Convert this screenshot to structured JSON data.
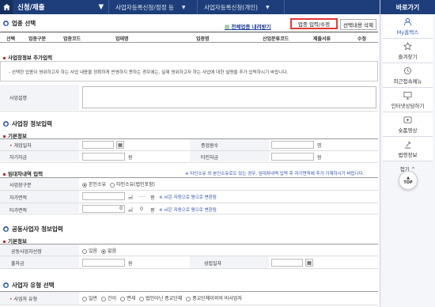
{
  "breadcrumb": {
    "first": "신청/제출",
    "second": "사업자등록신청/정정 등",
    "third": "사업자등록신청(개인)"
  },
  "sidebar": {
    "title": "바로가기",
    "items": [
      {
        "label": "My홈택스",
        "icon": "person-icon"
      },
      {
        "label": "즐겨찾기",
        "icon": "star-icon"
      },
      {
        "label": "최근접속메뉴",
        "icon": "clock-icon"
      },
      {
        "label": "인터넷상담하기",
        "icon": "monitor-icon"
      },
      {
        "label": "숏폼영상",
        "icon": "play-icon"
      },
      {
        "label": "법령정보",
        "icon": "scale-icon"
      }
    ],
    "collapse": "접기 ^",
    "top": "TOP"
  },
  "industry": {
    "title": "업종 선택",
    "download_link": "전체업종 내려받기",
    "input_button": "업종 입력/수정",
    "delete_button": "선택내용 삭제",
    "columns": [
      "선택",
      "업종구분",
      "업종코드",
      "업태명",
      "업종명",
      "산업분류코드",
      "제출서류",
      "수정"
    ]
  },
  "business_info_extra": {
    "title": "사업장정보 추가입력",
    "desc": "- 선택한 업종이 영위하고자 하는 사업 내용을 정확하게 반영하지 못하는 경우에는, 실제 영위하고자 하는 사업에 대한 설명을 추가 입력하시기 바랍니다.",
    "field_label": "사업설명"
  },
  "business_info": {
    "title": "사업장 정보입력",
    "basic_title": "기본정보",
    "open_date": "개업일자",
    "employees": "종업원수",
    "employees_unit": "명",
    "own_funds": "자기자금",
    "own_funds_unit": "원",
    "other_funds": "타인자금",
    "other_funds_unit": "원",
    "lease_title": "임대차내역 입력",
    "lease_note": "※ 타인소유 외 본인소유로도 있는 경우, 임대차내역 입력 후 자가면적에 추가 기재하시기 바랍니다.",
    "site_type": "사업장구분",
    "site_own": "본인소유",
    "site_other": "타인소유(법인포함)",
    "own_area": "자가면적",
    "other_area": "타가면적",
    "area_unit": "㎡",
    "pyeong_unit": "평",
    "area_value": "0",
    "pyeong_value": "0",
    "area_note": "※ ㎡은 자동으로 평으로 변환됨"
  },
  "joint": {
    "title": "공동사업자 정보입력",
    "basic_title": "기본정보",
    "is_joint": "공동사업자선정",
    "yes": "있음",
    "no": "없음",
    "investment": "출자금",
    "investment_unit": "원",
    "agreement_date": "성립일자"
  },
  "biz_type": {
    "title": "사업자 유형 선택",
    "label": "사업자 유형",
    "options": [
      "일반",
      "간이",
      "면세",
      "법인아닌 종교단체",
      "종교단체이외의 비사업자"
    ]
  }
}
